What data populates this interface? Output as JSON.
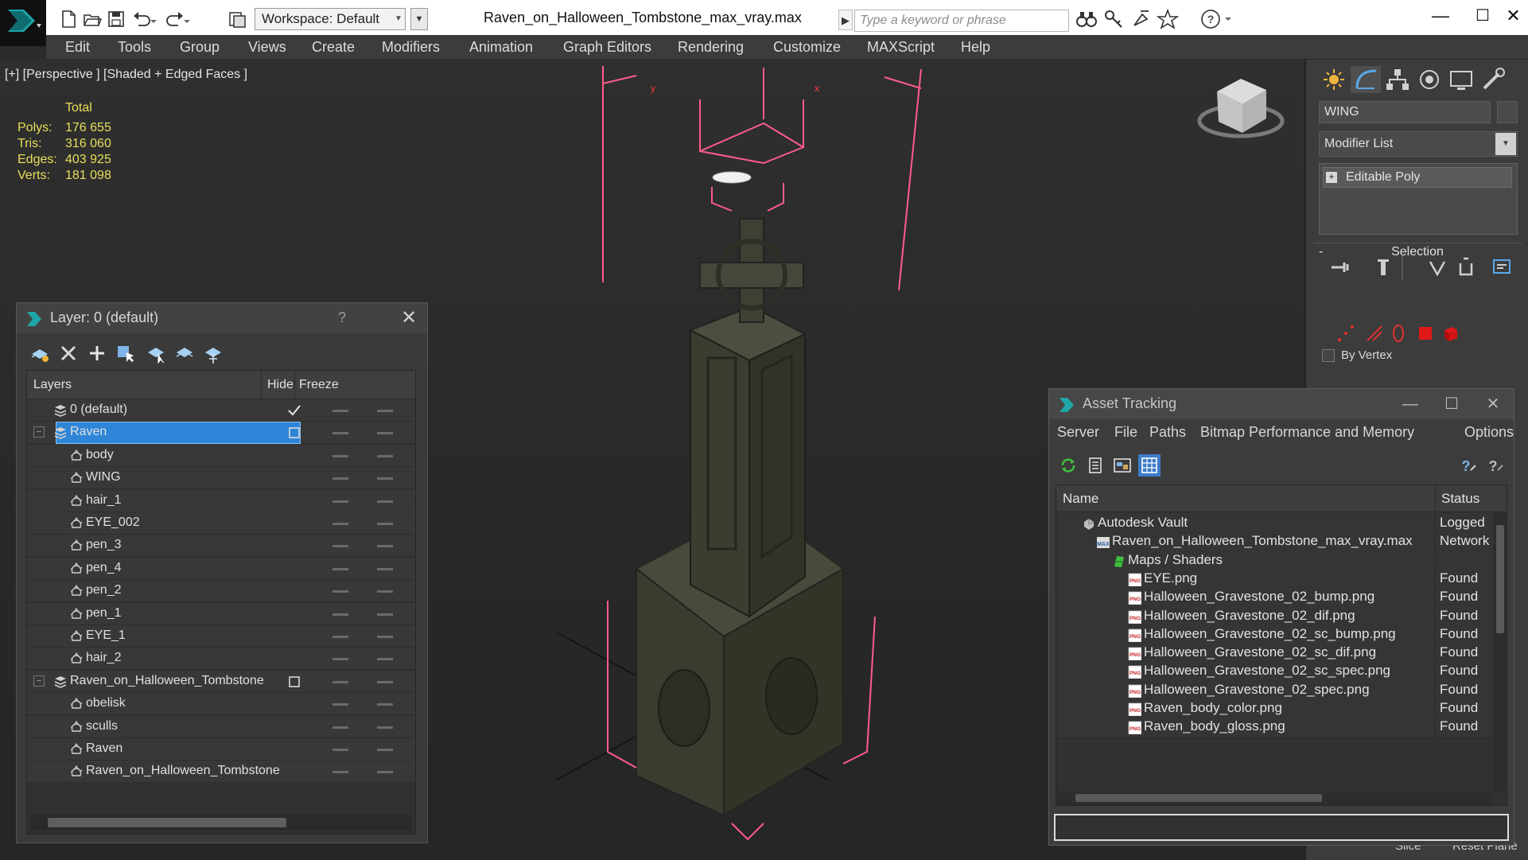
{
  "app": {
    "doc_title": "Raven_on_Halloween_Tombstone_max_vray.max",
    "workspace": "Workspace: Default",
    "search_placeholder": "Type a keyword or phrase"
  },
  "menu": [
    "Edit",
    "Tools",
    "Group",
    "Views",
    "Create",
    "Modifiers",
    "Animation",
    "Graph Editors",
    "Rendering",
    "Customize",
    "MAXScript",
    "Help"
  ],
  "viewport": {
    "label": "[+] [Perspective ] [Shaded + Edged Faces ]",
    "stats_header": "Total",
    "stats": [
      {
        "label": "Polys:",
        "value": "176 655"
      },
      {
        "label": "Tris:",
        "value": "316 060"
      },
      {
        "label": "Edges:",
        "value": "403 925"
      },
      {
        "label": "Verts:",
        "value": "181 098"
      }
    ]
  },
  "command_panel": {
    "object_name": "WING",
    "modifier_list": "Modifier List",
    "stack_item": "Editable Poly",
    "selection_title": "Selection",
    "selection_collapse": "-",
    "by_vertex": "By Vertex",
    "slice_label": "Slice",
    "reset_plane_label": "Reset Plane"
  },
  "layer_dialog": {
    "title": "Layer: 0 (default)",
    "help": "?",
    "columns": {
      "layers": "Layers",
      "hide": "Hide",
      "freeze": "Freeze"
    },
    "rows": [
      {
        "name": "0 (default)",
        "type": "layer",
        "indent": 0,
        "current": true
      },
      {
        "name": "Raven",
        "type": "layer",
        "indent": 0,
        "selected": true,
        "expanded": true
      },
      {
        "name": "body",
        "type": "object",
        "indent": 1
      },
      {
        "name": "WING",
        "type": "object",
        "indent": 1
      },
      {
        "name": "hair_1",
        "type": "object",
        "indent": 1
      },
      {
        "name": "EYE_002",
        "type": "object",
        "indent": 1
      },
      {
        "name": "pen_3",
        "type": "object",
        "indent": 1
      },
      {
        "name": "pen_4",
        "type": "object",
        "indent": 1
      },
      {
        "name": "pen_2",
        "type": "object",
        "indent": 1
      },
      {
        "name": "pen_1",
        "type": "object",
        "indent": 1
      },
      {
        "name": "EYE_1",
        "type": "object",
        "indent": 1
      },
      {
        "name": "hair_2",
        "type": "object",
        "indent": 1
      },
      {
        "name": "Raven_on_Halloween_Tombstone",
        "type": "layer",
        "indent": 0,
        "expanded": true
      },
      {
        "name": "obelisk",
        "type": "object",
        "indent": 1
      },
      {
        "name": "sculls",
        "type": "object",
        "indent": 1
      },
      {
        "name": "Raven",
        "type": "object",
        "indent": 1
      },
      {
        "name": "Raven_on_Halloween_Tombstone",
        "type": "object",
        "indent": 1
      }
    ]
  },
  "asset_dialog": {
    "title": "Asset Tracking",
    "menu": [
      "Server",
      "File",
      "Paths",
      "Bitmap Performance and Memory",
      "Options"
    ],
    "columns": {
      "name": "Name",
      "status": "Status"
    },
    "rows": [
      {
        "name": "Autodesk Vault",
        "status": "Logged",
        "indent": 1,
        "icon": "vault"
      },
      {
        "name": "Raven_on_Halloween_Tombstone_max_vray.max",
        "status": "Network",
        "indent": 2,
        "icon": "max"
      },
      {
        "name": "Maps / Shaders",
        "status": "",
        "indent": 3,
        "icon": "maps"
      },
      {
        "name": "EYE.png",
        "status": "Found",
        "indent": 4,
        "icon": "png"
      },
      {
        "name": "Halloween_Gravestone_02_bump.png",
        "status": "Found",
        "indent": 4,
        "icon": "png"
      },
      {
        "name": "Halloween_Gravestone_02_dif.png",
        "status": "Found",
        "indent": 4,
        "icon": "png"
      },
      {
        "name": "Halloween_Gravestone_02_sc_bump.png",
        "status": "Found",
        "indent": 4,
        "icon": "png"
      },
      {
        "name": "Halloween_Gravestone_02_sc_dif.png",
        "status": "Found",
        "indent": 4,
        "icon": "png"
      },
      {
        "name": "Halloween_Gravestone_02_sc_spec.png",
        "status": "Found",
        "indent": 4,
        "icon": "png"
      },
      {
        "name": "Halloween_Gravestone_02_spec.png",
        "status": "Found",
        "indent": 4,
        "icon": "png"
      },
      {
        "name": "Raven_body_color.png",
        "status": "Found",
        "indent": 4,
        "icon": "png"
      },
      {
        "name": "Raven_body_gloss.png",
        "status": "Found",
        "indent": 4,
        "icon": "png"
      }
    ]
  },
  "colors": {
    "accent": "#2f86d8",
    "stats": "#e8df5a",
    "selection_box": "#ff5c8a"
  }
}
